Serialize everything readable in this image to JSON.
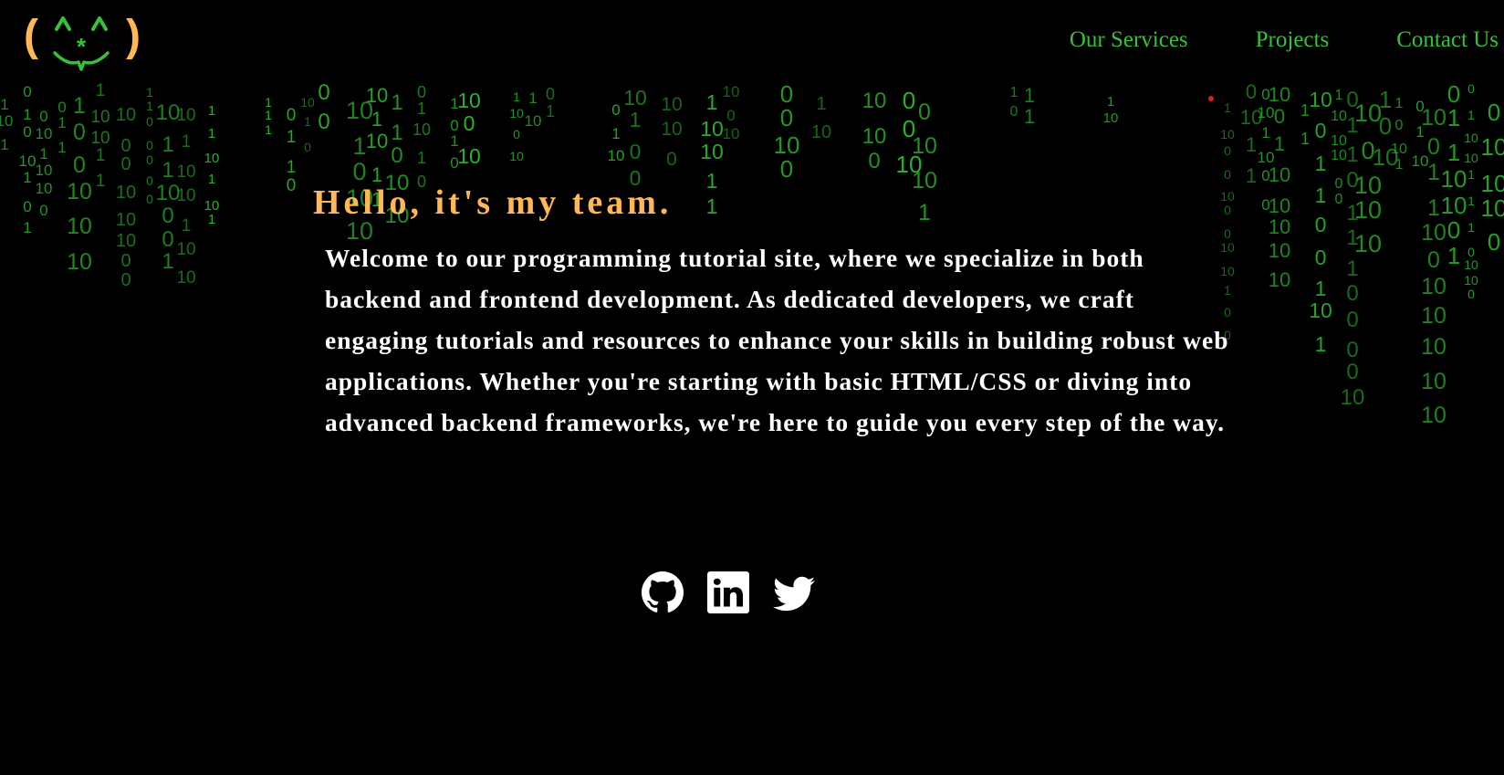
{
  "header": {
    "logo": {
      "left_paren": "(",
      "right_paren": ")",
      "icon": "ascii-cat-face-logo"
    },
    "nav": [
      {
        "label": "Our Services"
      },
      {
        "label": "Projects"
      },
      {
        "label": "Contact Us"
      }
    ]
  },
  "hero": {
    "title": "Hello, it's my team.",
    "body": "Welcome to our programming tutorial site, where we specialize in both backend and frontend development. As dedicated developers, we craft engaging tutorials and resources to enhance your skills in building robust web applications. Whether you're starting with basic HTML/CSS or diving into advanced backend frameworks, we're here to guide you every step of the way."
  },
  "social": [
    {
      "name": "github",
      "icon": "github-icon"
    },
    {
      "name": "linkedin",
      "icon": "linkedin-icon"
    },
    {
      "name": "twitter",
      "icon": "twitter-icon"
    }
  ],
  "background": {
    "effect": "binary-matrix-rain",
    "glyphs": [
      "0",
      "1",
      "10"
    ]
  },
  "colors": {
    "background": "#000000",
    "accent": "#ffb854",
    "nav_link": "#36c236",
    "rain": "#2bb52b",
    "body_text": "#ffffff"
  }
}
